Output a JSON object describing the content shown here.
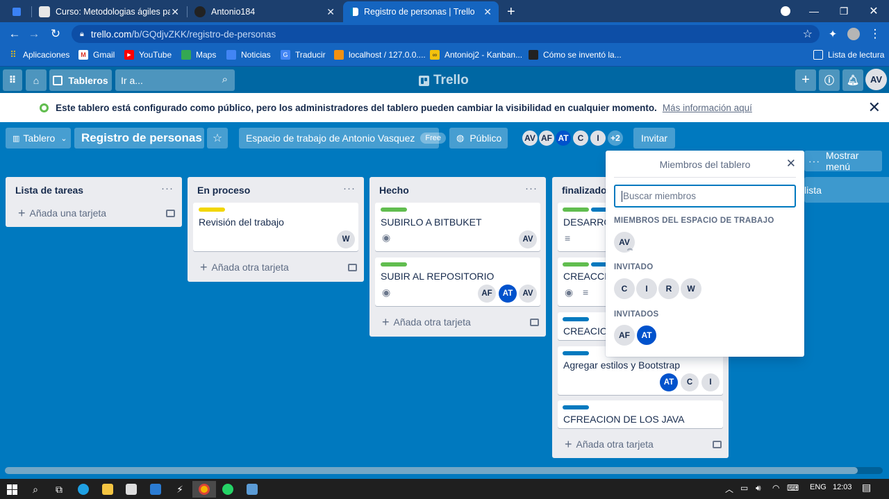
{
  "browser": {
    "tabs": [
      {
        "title": "Curso: Metodologias ágiles para",
        "active": false
      },
      {
        "title": "Antonio184",
        "active": false
      },
      {
        "title": "Registro de personas | Trello",
        "active": true
      }
    ],
    "new_tab": "+",
    "url_host": "trello.com",
    "url_path": "/b/GQdjvZKK/registro-de-personas",
    "bookmarks": [
      "Aplicaciones",
      "Gmail",
      "YouTube",
      "Maps",
      "Noticias",
      "Traducir",
      "localhost / 127.0.0....",
      "Antonioj2 - Kanban...",
      "Cómo se inventó la..."
    ],
    "reading_list": "Lista de lectura"
  },
  "trello": {
    "boards_label": "Tableros",
    "search_placeholder": "Ir a...",
    "logo": "Trello",
    "user_initials": "AV"
  },
  "notice": {
    "text": "Este tablero está configurado como público, pero los administradores del tablero pueden cambiar la visibilidad en cualquier momento.",
    "link": "Más información aquí"
  },
  "board": {
    "view": "Tablero",
    "name": "Registro de personas",
    "workspace": "Espacio de trabajo de Antonio Vasquez",
    "plan": "Free",
    "visibility": "Público",
    "members": [
      "AV",
      "AF",
      "AT",
      "C",
      "I"
    ],
    "more_members": "+2",
    "invite": "Invitar",
    "show_menu": "Mostrar menú"
  },
  "lists": [
    {
      "title": "Lista de tareas",
      "add": "Añada una tarjeta",
      "cards": []
    },
    {
      "title": "En proceso",
      "add": "Añada otra tarjeta",
      "cards": [
        {
          "title": "Revisión del trabajo",
          "members": [
            "W"
          ]
        }
      ]
    },
    {
      "title": "Hecho",
      "add": "Añada otra tarjeta",
      "cards": [
        {
          "title": "SUBIRLO A BITBUKET",
          "members": [
            "AV"
          ]
        },
        {
          "title": "SUBIR AL REPOSITORIO",
          "members": [
            "AF",
            "AT",
            "AV"
          ]
        }
      ]
    },
    {
      "title": "finalizado",
      "add": "Añada otra tarjeta",
      "cards": [
        {
          "title": "DESARROL"
        },
        {
          "title": "CREACCIO"
        },
        {
          "title": "CREACION"
        },
        {
          "title": "Agregar estilos y Bootstrap",
          "members": [
            "AT",
            "C",
            "I"
          ]
        },
        {
          "title": "CFREACION DE LOS JAVA"
        }
      ]
    }
  ],
  "ghost_list": "lista",
  "popover": {
    "title": "Miembros del tablero",
    "search_placeholder": "Buscar miembros",
    "sections": [
      {
        "title": "MIEMBROS DEL ESPACIO DE TRABAJO",
        "members": [
          "AV"
        ]
      },
      {
        "title": "INVITADO",
        "members": [
          "C",
          "I",
          "R",
          "W"
        ]
      },
      {
        "title": "INVITADOS",
        "members": [
          "AF",
          "AT"
        ]
      }
    ]
  },
  "taskbar": {
    "lang": "ENG",
    "time": "12:03"
  },
  "colors": {
    "board_bg": "#0079bf",
    "label_green": "#61bd4f",
    "label_yellow": "#f2d600",
    "label_blue": "#0079bf",
    "avatar_blue": "#0052cc"
  }
}
